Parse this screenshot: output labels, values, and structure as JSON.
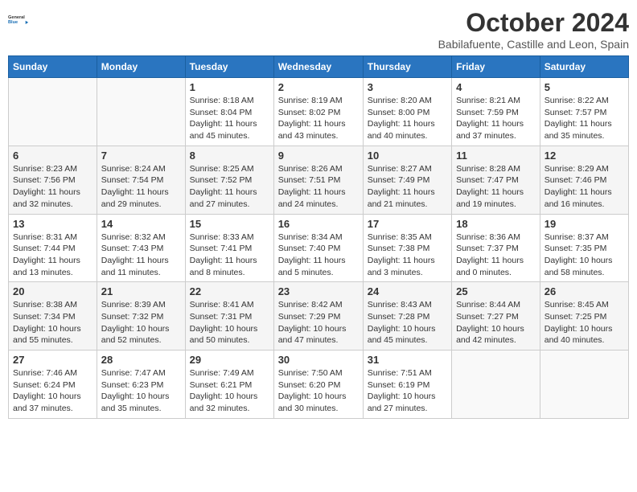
{
  "header": {
    "logo_line1": "General",
    "logo_line2": "Blue",
    "month_title": "October 2024",
    "subtitle": "Babilafuente, Castille and Leon, Spain"
  },
  "weekdays": [
    "Sunday",
    "Monday",
    "Tuesday",
    "Wednesday",
    "Thursday",
    "Friday",
    "Saturday"
  ],
  "weeks": [
    [
      {
        "day": "",
        "empty": true
      },
      {
        "day": "",
        "empty": true
      },
      {
        "day": "1",
        "sunrise": "8:18 AM",
        "sunset": "8:04 PM",
        "daylight": "11 hours and 45 minutes."
      },
      {
        "day": "2",
        "sunrise": "8:19 AM",
        "sunset": "8:02 PM",
        "daylight": "11 hours and 43 minutes."
      },
      {
        "day": "3",
        "sunrise": "8:20 AM",
        "sunset": "8:00 PM",
        "daylight": "11 hours and 40 minutes."
      },
      {
        "day": "4",
        "sunrise": "8:21 AM",
        "sunset": "7:59 PM",
        "daylight": "11 hours and 37 minutes."
      },
      {
        "day": "5",
        "sunrise": "8:22 AM",
        "sunset": "7:57 PM",
        "daylight": "11 hours and 35 minutes."
      }
    ],
    [
      {
        "day": "6",
        "sunrise": "8:23 AM",
        "sunset": "7:56 PM",
        "daylight": "11 hours and 32 minutes."
      },
      {
        "day": "7",
        "sunrise": "8:24 AM",
        "sunset": "7:54 PM",
        "daylight": "11 hours and 29 minutes."
      },
      {
        "day": "8",
        "sunrise": "8:25 AM",
        "sunset": "7:52 PM",
        "daylight": "11 hours and 27 minutes."
      },
      {
        "day": "9",
        "sunrise": "8:26 AM",
        "sunset": "7:51 PM",
        "daylight": "11 hours and 24 minutes."
      },
      {
        "day": "10",
        "sunrise": "8:27 AM",
        "sunset": "7:49 PM",
        "daylight": "11 hours and 21 minutes."
      },
      {
        "day": "11",
        "sunrise": "8:28 AM",
        "sunset": "7:47 PM",
        "daylight": "11 hours and 19 minutes."
      },
      {
        "day": "12",
        "sunrise": "8:29 AM",
        "sunset": "7:46 PM",
        "daylight": "11 hours and 16 minutes."
      }
    ],
    [
      {
        "day": "13",
        "sunrise": "8:31 AM",
        "sunset": "7:44 PM",
        "daylight": "11 hours and 13 minutes."
      },
      {
        "day": "14",
        "sunrise": "8:32 AM",
        "sunset": "7:43 PM",
        "daylight": "11 hours and 11 minutes."
      },
      {
        "day": "15",
        "sunrise": "8:33 AM",
        "sunset": "7:41 PM",
        "daylight": "11 hours and 8 minutes."
      },
      {
        "day": "16",
        "sunrise": "8:34 AM",
        "sunset": "7:40 PM",
        "daylight": "11 hours and 5 minutes."
      },
      {
        "day": "17",
        "sunrise": "8:35 AM",
        "sunset": "7:38 PM",
        "daylight": "11 hours and 3 minutes."
      },
      {
        "day": "18",
        "sunrise": "8:36 AM",
        "sunset": "7:37 PM",
        "daylight": "11 hours and 0 minutes."
      },
      {
        "day": "19",
        "sunrise": "8:37 AM",
        "sunset": "7:35 PM",
        "daylight": "10 hours and 58 minutes."
      }
    ],
    [
      {
        "day": "20",
        "sunrise": "8:38 AM",
        "sunset": "7:34 PM",
        "daylight": "10 hours and 55 minutes."
      },
      {
        "day": "21",
        "sunrise": "8:39 AM",
        "sunset": "7:32 PM",
        "daylight": "10 hours and 52 minutes."
      },
      {
        "day": "22",
        "sunrise": "8:41 AM",
        "sunset": "7:31 PM",
        "daylight": "10 hours and 50 minutes."
      },
      {
        "day": "23",
        "sunrise": "8:42 AM",
        "sunset": "7:29 PM",
        "daylight": "10 hours and 47 minutes."
      },
      {
        "day": "24",
        "sunrise": "8:43 AM",
        "sunset": "7:28 PM",
        "daylight": "10 hours and 45 minutes."
      },
      {
        "day": "25",
        "sunrise": "8:44 AM",
        "sunset": "7:27 PM",
        "daylight": "10 hours and 42 minutes."
      },
      {
        "day": "26",
        "sunrise": "8:45 AM",
        "sunset": "7:25 PM",
        "daylight": "10 hours and 40 minutes."
      }
    ],
    [
      {
        "day": "27",
        "sunrise": "7:46 AM",
        "sunset": "6:24 PM",
        "daylight": "10 hours and 37 minutes."
      },
      {
        "day": "28",
        "sunrise": "7:47 AM",
        "sunset": "6:23 PM",
        "daylight": "10 hours and 35 minutes."
      },
      {
        "day": "29",
        "sunrise": "7:49 AM",
        "sunset": "6:21 PM",
        "daylight": "10 hours and 32 minutes."
      },
      {
        "day": "30",
        "sunrise": "7:50 AM",
        "sunset": "6:20 PM",
        "daylight": "10 hours and 30 minutes."
      },
      {
        "day": "31",
        "sunrise": "7:51 AM",
        "sunset": "6:19 PM",
        "daylight": "10 hours and 27 minutes."
      },
      {
        "day": "",
        "empty": true
      },
      {
        "day": "",
        "empty": true
      }
    ]
  ],
  "labels": {
    "sunrise": "Sunrise:",
    "sunset": "Sunset:",
    "daylight": "Daylight:"
  }
}
